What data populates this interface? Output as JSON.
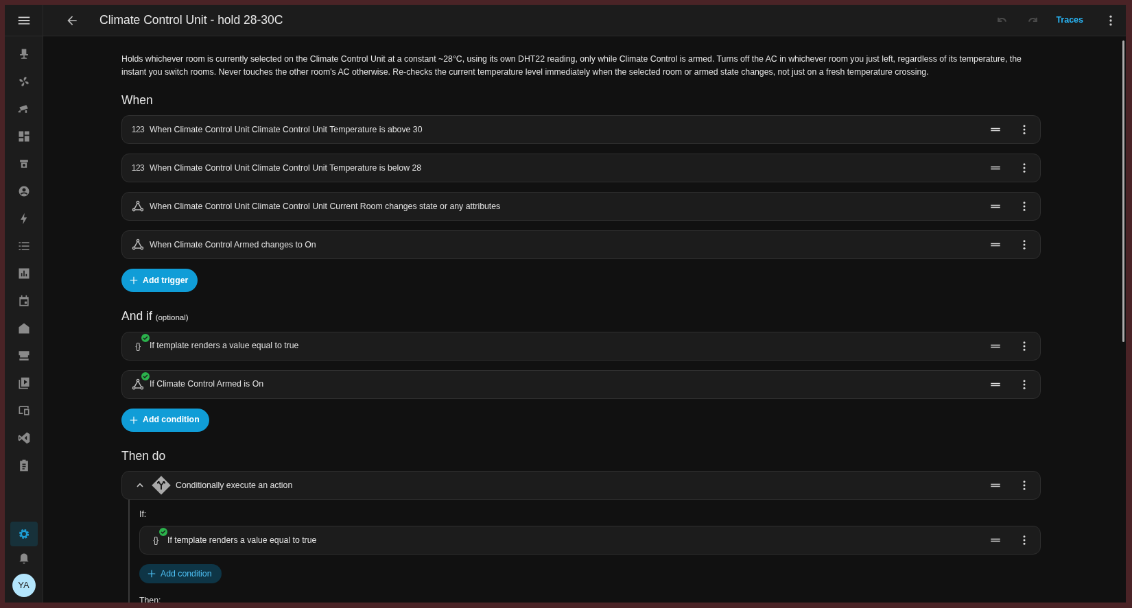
{
  "header": {
    "title": "Climate Control Unit - hold 28-30C",
    "undo_disabled": true,
    "redo_disabled": true,
    "traces": "Traces"
  },
  "sidebar": {
    "items": [
      {
        "selected": false
      },
      {
        "selected": false
      },
      {
        "selected": false
      },
      {
        "selected": false
      },
      {
        "selected": false
      },
      {
        "selected": false
      },
      {
        "selected": false
      },
      {
        "selected": false
      },
      {
        "selected": false
      },
      {
        "selected": false
      },
      {
        "selected": false
      },
      {
        "selected": false
      },
      {
        "selected": false
      },
      {
        "selected": false
      },
      {
        "selected": false
      },
      {
        "selected": false
      }
    ],
    "bottom": [
      {
        "kind": "settings",
        "selected": true
      },
      {
        "kind": "notifications",
        "selected": false
      }
    ],
    "avatar": "YA"
  },
  "description": "Holds whichever room is currently selected on the Climate Control Unit at a constant ~28°C, using its own DHT22 reading, only while Climate Control is armed. Turns off the AC in whichever room you just left, regardless of its temperature, the instant you switch rooms. Never touches the other room's AC otherwise. Re-checks the current temperature level immediately when the selected room or armed state changes, not just on a fresh temperature crossing.",
  "triggers": {
    "heading": "When",
    "items": [
      {
        "kind": "numeric",
        "glyph": "123",
        "text": "When Climate Control Unit Climate Control Unit Temperature is above 30"
      },
      {
        "kind": "numeric",
        "glyph": "123",
        "text": "When Climate Control Unit Climate Control Unit Temperature is below 28"
      },
      {
        "kind": "state",
        "text": "When Climate Control Unit Climate Control Unit Current Room changes state or any attributes"
      },
      {
        "kind": "state",
        "text": "When Climate Control Armed changes to On"
      }
    ],
    "add": "Add trigger"
  },
  "conditions": {
    "heading": "And if",
    "hint": "(optional)",
    "items": [
      {
        "kind": "template",
        "glyph": "{}",
        "valid": true,
        "text": "If template renders a value equal to true"
      },
      {
        "kind": "state",
        "valid": true,
        "text": "If Climate Control Armed is On"
      }
    ],
    "add": "Add condition"
  },
  "actions": {
    "heading": "Then do",
    "items": [
      {
        "kind": "choose",
        "expanded": true,
        "text": "Conditionally execute an action",
        "if_label": "If:",
        "conditions": [
          {
            "kind": "template",
            "glyph": "{}",
            "valid": true,
            "text": "If template renders a value equal to true"
          }
        ],
        "add": "Add condition",
        "then_label": "Then:"
      }
    ]
  }
}
